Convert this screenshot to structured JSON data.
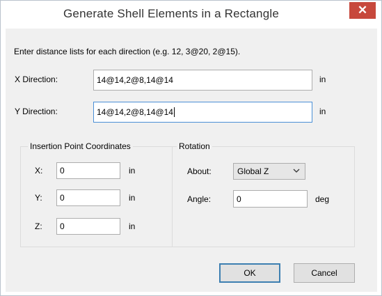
{
  "window": {
    "title": "Generate Shell Elements in a Rectangle",
    "close_glyph": "✕"
  },
  "instructions": "Enter distance lists for each direction (e.g. 12, 3@20, 2@15).",
  "x_direction": {
    "label": "X Direction:",
    "value": "14@14,2@8,14@14",
    "unit": "in"
  },
  "y_direction": {
    "label": "Y Direction:",
    "value": "14@14,2@8,14@14",
    "unit": "in"
  },
  "insertion_point": {
    "title": "Insertion Point Coordinates",
    "x": {
      "label": "X:",
      "value": "0",
      "unit": "in"
    },
    "y": {
      "label": "Y:",
      "value": "0",
      "unit": "in"
    },
    "z": {
      "label": "Z:",
      "value": "0",
      "unit": "in"
    }
  },
  "rotation": {
    "title": "Rotation",
    "about": {
      "label": "About:",
      "value": "Global Z"
    },
    "angle": {
      "label": "Angle:",
      "value": "0",
      "unit": "deg"
    }
  },
  "buttons": {
    "ok": "OK",
    "cancel": "Cancel"
  },
  "colors": {
    "close_button": "#c7483c",
    "focus_border": "#4a8fd6",
    "dialog_bg": "#f0f0f0"
  }
}
